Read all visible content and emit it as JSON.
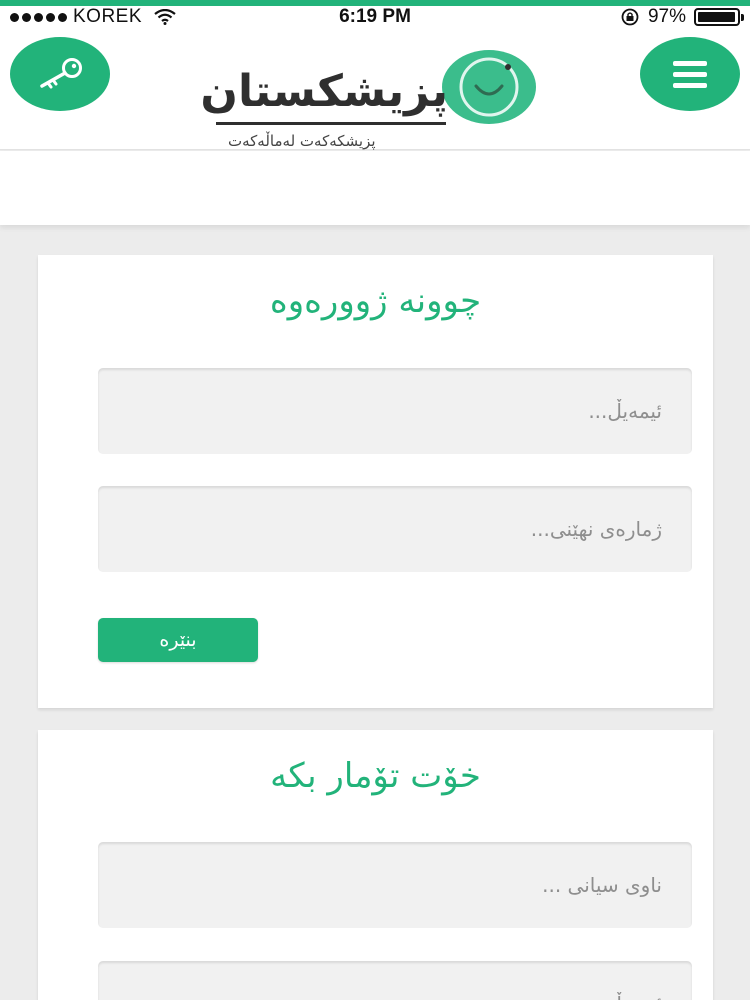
{
  "status_bar": {
    "carrier": "KOREK",
    "time": "6:19 PM",
    "battery": "97%",
    "battery_level": 0.97
  },
  "header": {
    "logo_title": "پزیشکستان",
    "logo_subtitle": "پزیشکەکەت لەماڵەکەت",
    "key_icon": "key-icon",
    "menu_icon": "hamburger-menu-icon"
  },
  "login": {
    "title": "چوونە ژوورەوە",
    "email_placeholder": "ئیمەیڵ...",
    "password_placeholder": "ژمارەی نهێنی...",
    "submit_label": "بنێرە"
  },
  "register": {
    "title": "خۆت تۆمار بکە",
    "name_placeholder": "ناوی سیانی ...",
    "email_placeholder": "ئیمەیڵ..."
  },
  "colors": {
    "accent": "#22b37a",
    "background": "#ececec",
    "field_bg": "#f1f1f1"
  }
}
